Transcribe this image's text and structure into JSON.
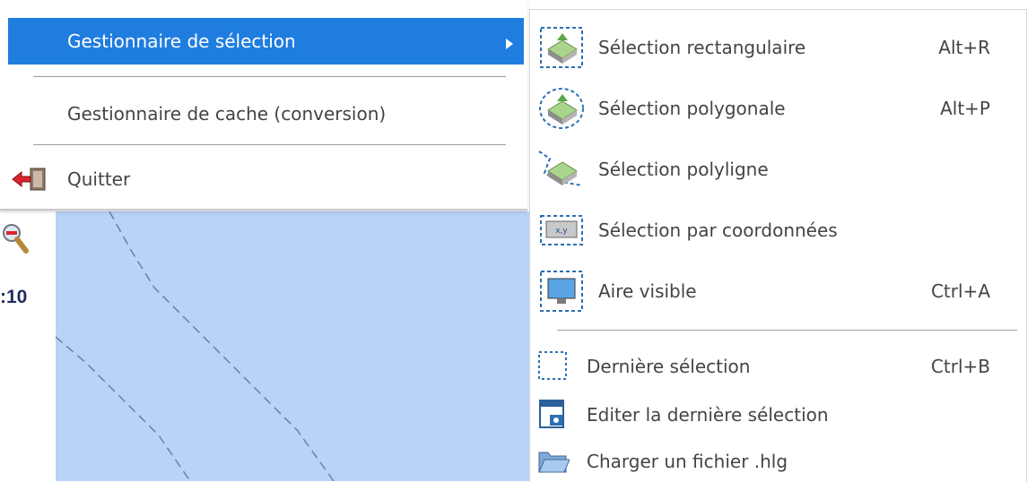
{
  "main_menu": {
    "items": [
      {
        "label": "Gestionnaire de sélection",
        "icon": "none",
        "selected": true,
        "has_submenu": true
      },
      {
        "label": "Gestionnaire de cache (conversion)",
        "icon": "none",
        "selected": false,
        "has_submenu": false
      },
      {
        "label": "Quitter",
        "icon": "exit-door-icon",
        "selected": false,
        "has_submenu": false
      }
    ]
  },
  "submenu": {
    "items": [
      {
        "label": "Sélection rectangulaire",
        "shortcut": "Alt+R",
        "icon": "rectangle-selection-icon"
      },
      {
        "label": "Sélection polygonale",
        "shortcut": "Alt+P",
        "icon": "polygon-selection-icon"
      },
      {
        "label": "Sélection polyligne",
        "shortcut": "",
        "icon": "polyline-selection-icon"
      },
      {
        "label": "Sélection par coordonnées",
        "shortcut": "",
        "icon": "coordinates-selection-icon"
      },
      {
        "label": "Aire visible",
        "shortcut": "Ctrl+A",
        "icon": "visible-area-icon"
      },
      {
        "label": "Dernière sélection",
        "shortcut": "Ctrl+B",
        "icon": "dotted-rectangle-icon"
      },
      {
        "label": "Editer la dernière sélection",
        "shortcut": "",
        "icon": "edit-window-icon"
      },
      {
        "label": "Charger un fichier .hlg",
        "shortcut": "",
        "icon": "open-folder-icon"
      }
    ]
  },
  "background": {
    "scale_label": ":10",
    "map_color": "#b9d2f7"
  },
  "colors": {
    "highlight": "#1f7de0",
    "text": "#444444"
  }
}
